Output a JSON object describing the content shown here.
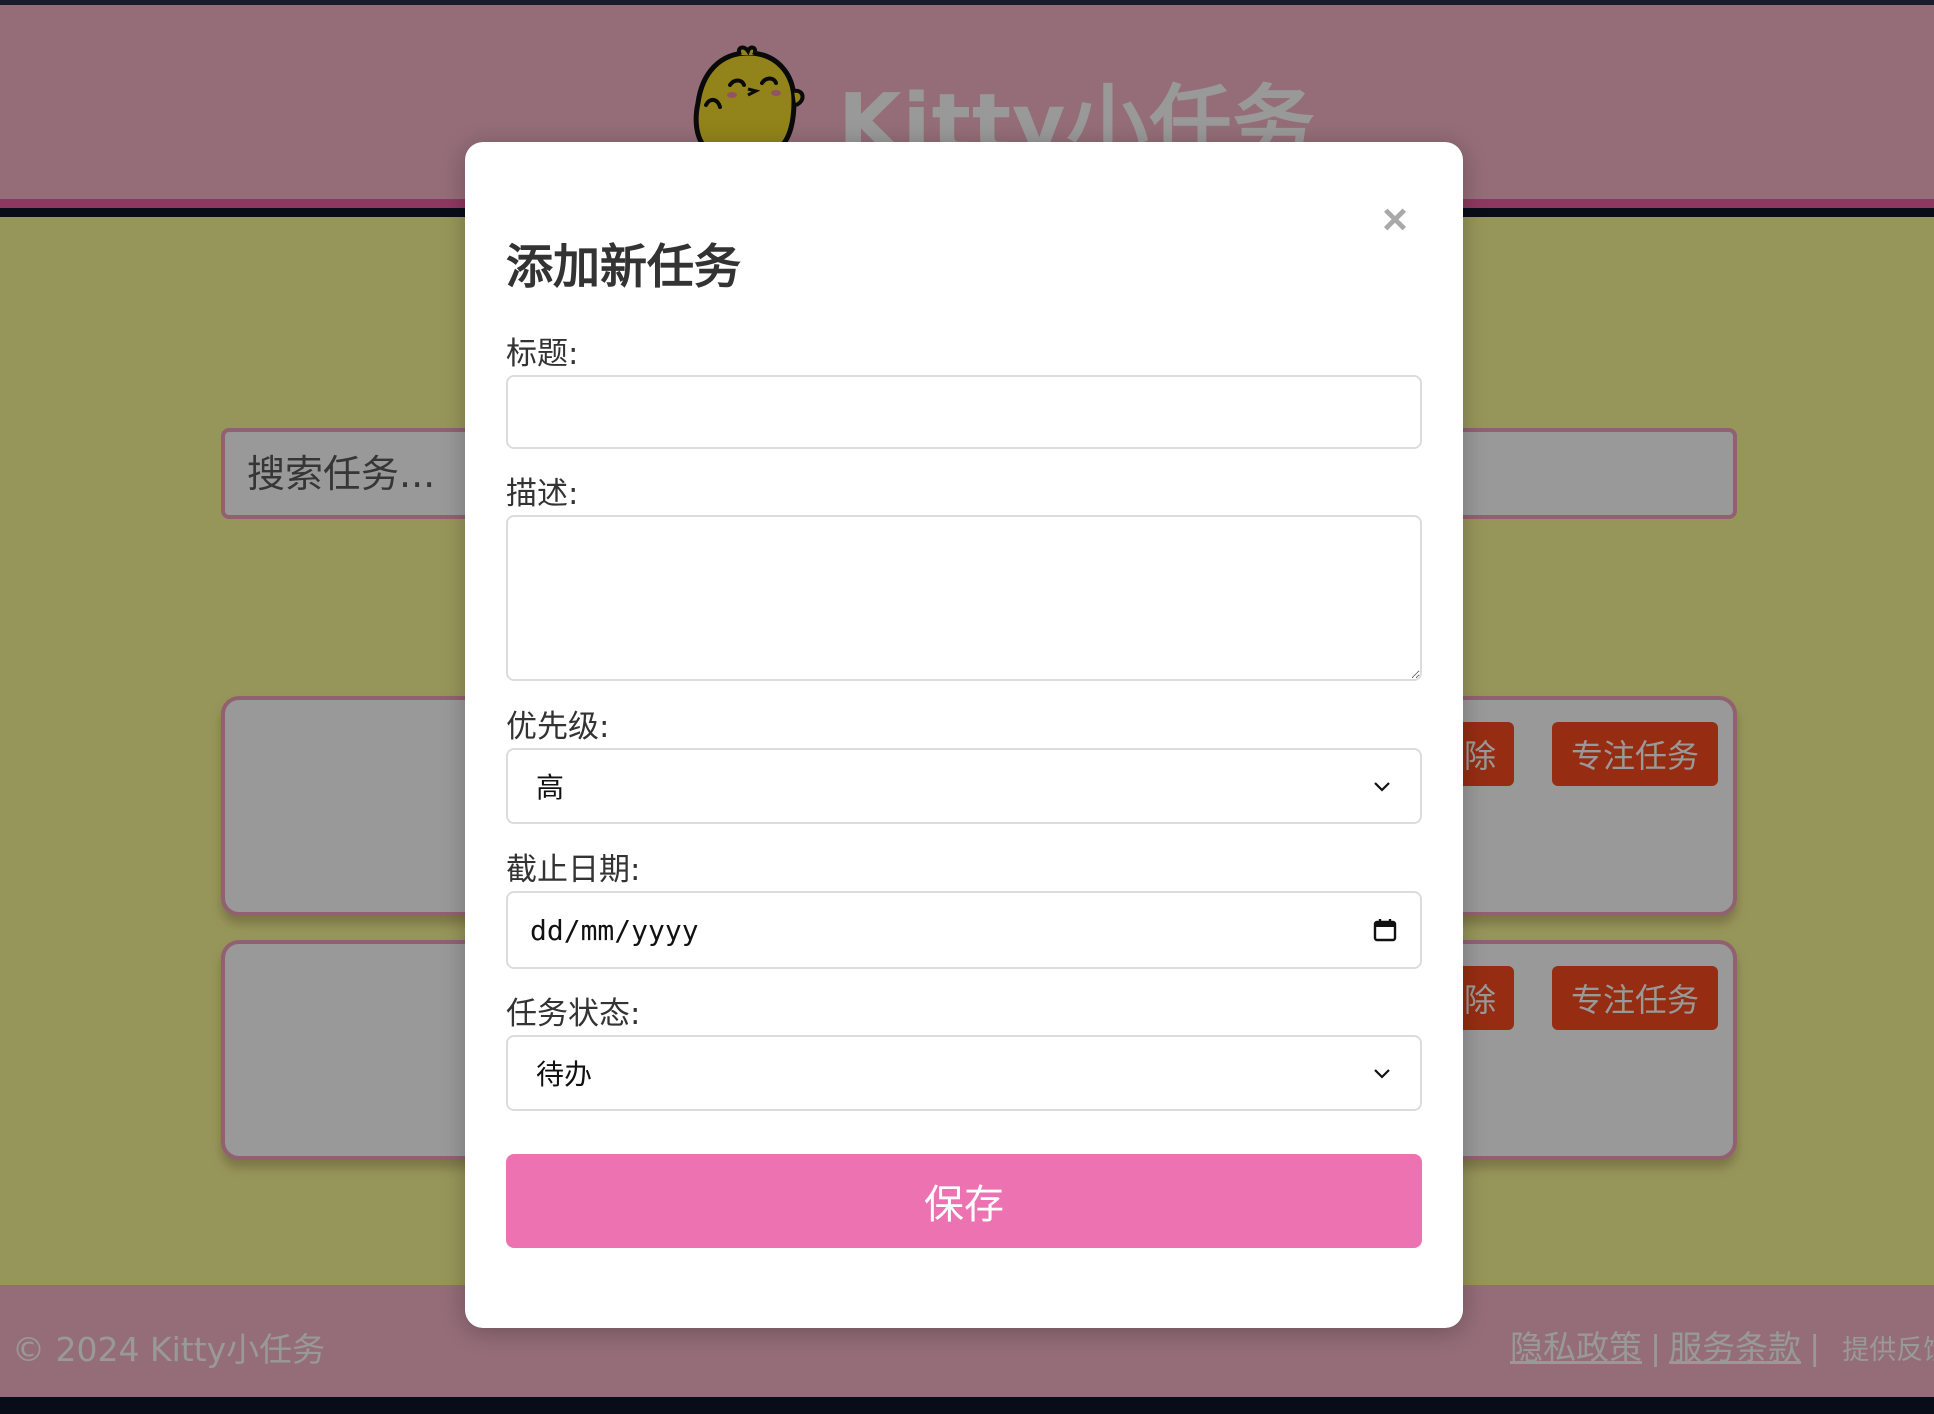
{
  "header": {
    "title": "Kitty小任务"
  },
  "search": {
    "placeholder": "搜索任务..."
  },
  "tasks": [
    {
      "delete_label": "删除",
      "focus_label": "专注任务"
    },
    {
      "delete_label": "删除",
      "focus_label": "专注任务"
    }
  ],
  "footer": {
    "copyright": "© 2024 Kitty小任务",
    "privacy": "隐私政策",
    "terms": "服务条款",
    "separator": "|",
    "feedback": "提供反馈"
  },
  "modal": {
    "title": "添加新任务",
    "close_label": "×",
    "title_label": "标题:",
    "title_value": "",
    "description_label": "描述:",
    "description_value": "",
    "priority_label": "优先级:",
    "priority_selected": "高",
    "due_date_label": "截止日期:",
    "due_date_placeholder": "dd/mm/yyyy",
    "status_label": "任务状态:",
    "status_selected": "待办",
    "save_label": "保存"
  },
  "colors": {
    "header_bg": "#f7b6c8",
    "header_border": "#ec5ea0",
    "main_bg": "#fcfa96",
    "action_button": "#fa4b1f",
    "save_button": "#ec72b1"
  },
  "icons": {
    "mascot": "chick-mascot-icon",
    "close": "close-icon",
    "select_arrow": "chevron-down-icon",
    "date": "calendar-icon"
  }
}
